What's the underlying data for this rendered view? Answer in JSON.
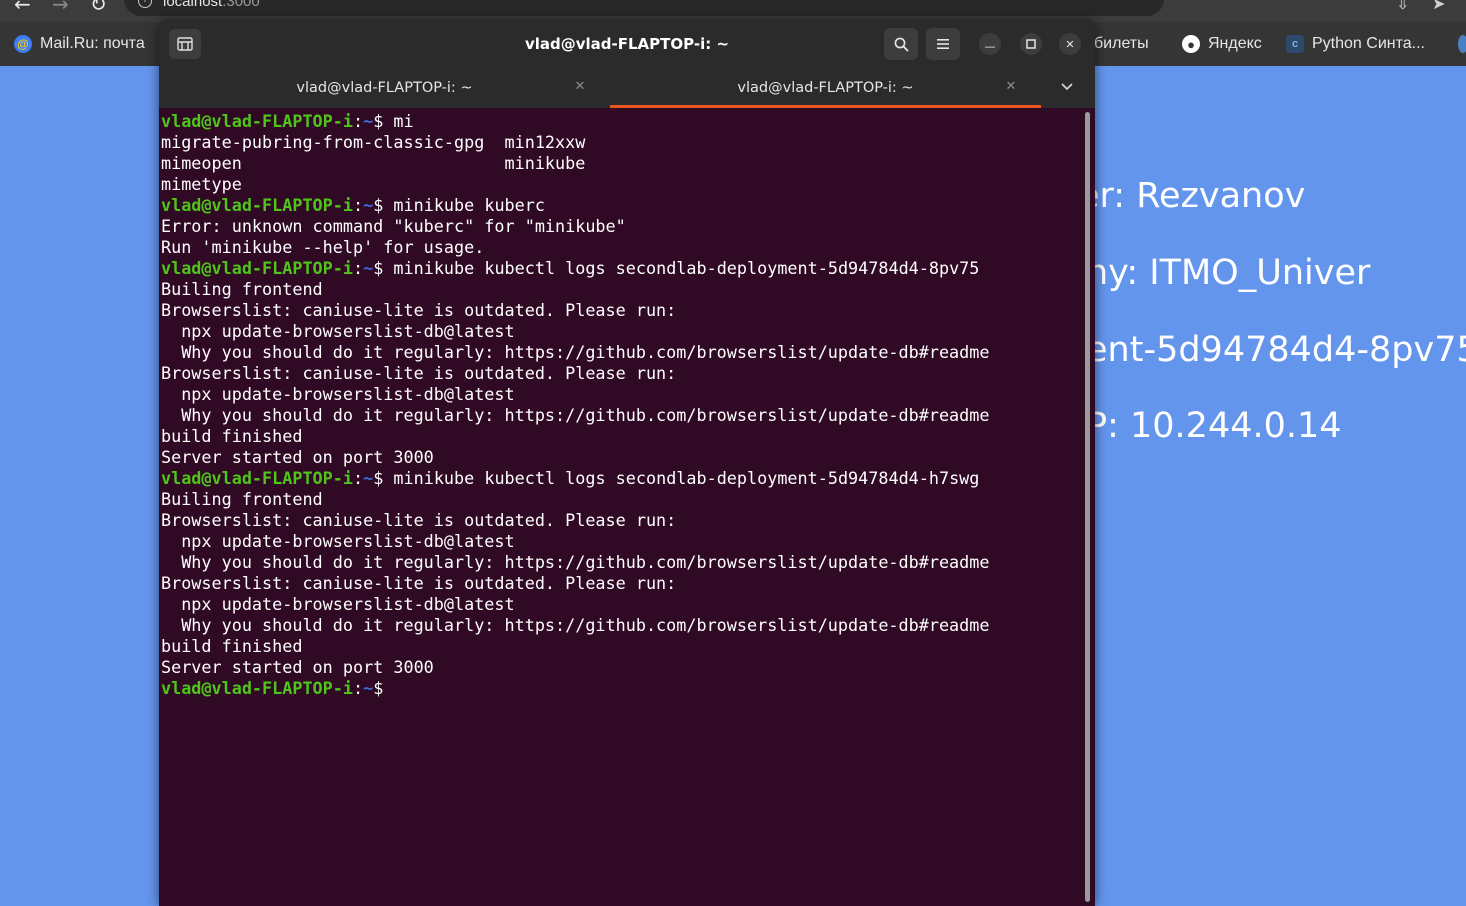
{
  "browser": {
    "url_host": "localhost",
    "url_port": ":3000",
    "bookmarks": [
      {
        "label": "Mail.Ru: почта",
        "icon": "at-icon",
        "color": "#3d7df6"
      },
      {
        "label": "билеты",
        "icon": "",
        "color": ""
      },
      {
        "label": "Яндекс",
        "icon": "globe-icon",
        "color": "#ffffff"
      },
      {
        "label": "Python Синта...",
        "icon": "doc-icon",
        "color": "#4a7fc1"
      }
    ]
  },
  "page": {
    "lines": [
      "er: Rezvanov",
      "ny: ITMO_Univer",
      "ent-5d94784d4-8pv75",
      "P: 10.244.0.14"
    ]
  },
  "terminal": {
    "title": "vlad@vlad-FLAPTOP-i: ~",
    "tabs": [
      {
        "label": "vlad@vlad-FLAPTOP-i: ~",
        "active": false
      },
      {
        "label": "vlad@vlad-FLAPTOP-i: ~",
        "active": true
      }
    ],
    "prompt": {
      "user": "vlad@vlad-FLAPTOP-i",
      "dir": "~",
      "symbol": "$ "
    },
    "lines": [
      {
        "cmd": "mi"
      },
      {
        "text": "migrate-pubring-from-classic-gpg  min12xxw"
      },
      {
        "text": "mimeopen                          minikube"
      },
      {
        "text": "mimetype"
      },
      {
        "cmd": "minikube kuberc"
      },
      {
        "text": "Error: unknown command \"kuberc\" for \"minikube\""
      },
      {
        "text": "Run 'minikube --help' for usage."
      },
      {
        "cmd": "minikube kubectl logs secondlab-deployment-5d94784d4-8pv75"
      },
      {
        "text": "Builing frontend"
      },
      {
        "text": "Browserslist: caniuse-lite is outdated. Please run:"
      },
      {
        "text": "  npx update-browserslist-db@latest"
      },
      {
        "text": "  Why you should do it regularly: https://github.com/browserslist/update-db#readme"
      },
      {
        "text": "Browserslist: caniuse-lite is outdated. Please run:"
      },
      {
        "text": "  npx update-browserslist-db@latest"
      },
      {
        "text": "  Why you should do it regularly: https://github.com/browserslist/update-db#readme"
      },
      {
        "text": "build finished"
      },
      {
        "text": "Server started on port 3000"
      },
      {
        "cmd": "minikube kubectl logs secondlab-deployment-5d94784d4-h7swg"
      },
      {
        "text": "Builing frontend"
      },
      {
        "text": "Browserslist: caniuse-lite is outdated. Please run:"
      },
      {
        "text": "  npx update-browserslist-db@latest"
      },
      {
        "text": "  Why you should do it regularly: https://github.com/browserslist/update-db#readme"
      },
      {
        "text": "Browserslist: caniuse-lite is outdated. Please run:"
      },
      {
        "text": "  npx update-browserslist-db@latest"
      },
      {
        "text": "  Why you should do it regularly: https://github.com/browserslist/update-db#readme"
      },
      {
        "text": "build finished"
      },
      {
        "text": "Server started on port 3000"
      },
      {
        "cmd": "",
        "cursor": true
      }
    ]
  },
  "colors": {
    "page_bg": "#6495ed",
    "terminal_bg": "#300a24",
    "prompt_user": "#4fc51a",
    "prompt_dir": "#3f6ad6",
    "accent": "#e95420"
  }
}
